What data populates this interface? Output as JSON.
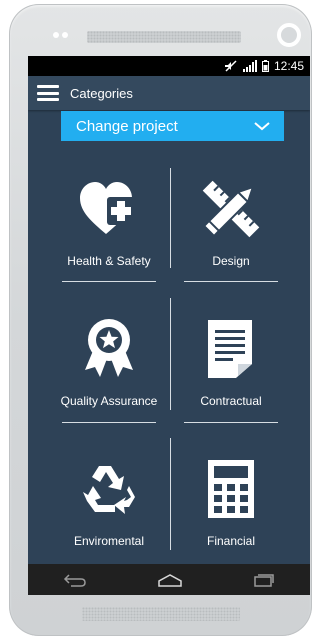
{
  "status": {
    "time": "12:45"
  },
  "appbar": {
    "title": "Categories"
  },
  "project": {
    "selected": "Change project"
  },
  "categories": [
    {
      "label": "Health & Safety",
      "icon": "heart-plus-icon"
    },
    {
      "label": "Design",
      "icon": "pencil-ruler-icon"
    },
    {
      "label": "Quality Assurance",
      "icon": "award-ribbon-icon"
    },
    {
      "label": "Contractual",
      "icon": "document-icon"
    },
    {
      "label": "Enviromental",
      "icon": "recycle-icon"
    },
    {
      "label": "Financial",
      "icon": "calculator-icon"
    }
  ],
  "colors": {
    "screen_bg": "#2e4257",
    "appbar_bg": "#34495e",
    "accent": "#22aef0",
    "navbar_bg": "#202020"
  }
}
